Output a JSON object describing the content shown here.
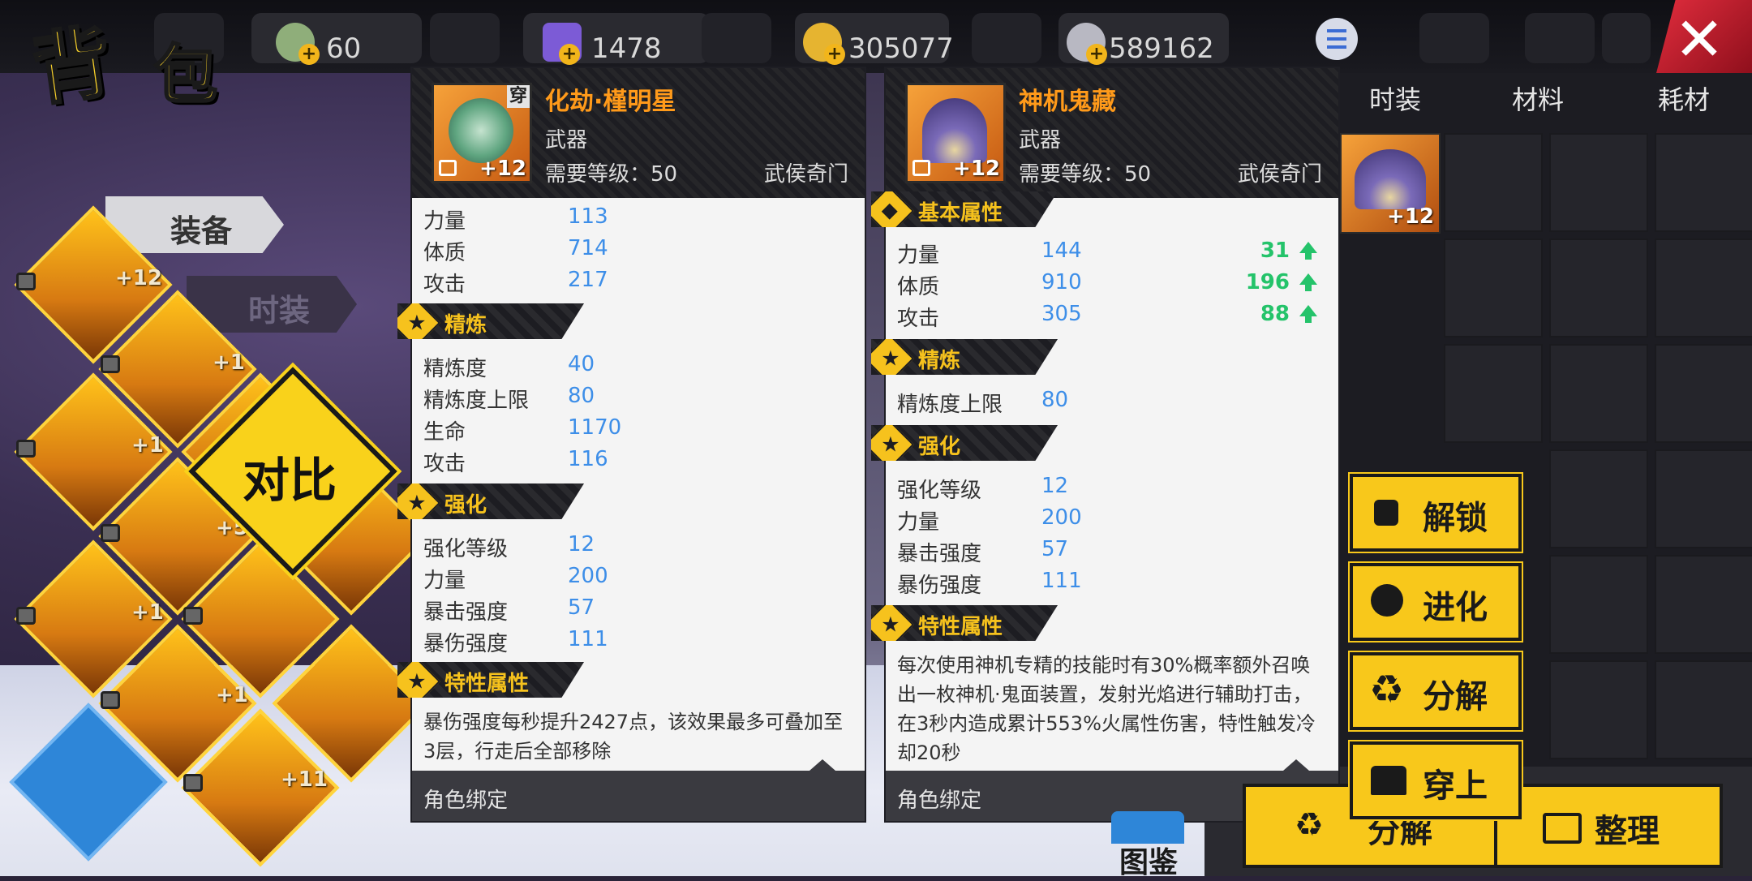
{
  "window": {
    "title_chars": [
      "背",
      "包"
    ]
  },
  "resources": [
    {
      "name": "voucher",
      "value": "60",
      "color": "#8fae7a"
    },
    {
      "name": "crystal",
      "value": "1478",
      "color": "#7c5bd6"
    },
    {
      "name": "gold",
      "value": "305077",
      "color": "#e6b430"
    },
    {
      "name": "silver",
      "value": "589162",
      "color": "#b8b8c2"
    }
  ],
  "left_tabs": {
    "equip": "装备",
    "fashion": "时装"
  },
  "compare_label": "对比",
  "slots_plus": [
    "+12",
    "+1",
    "+1",
    "+5",
    "+1",
    "+1",
    "+1",
    "+11"
  ],
  "panel_left": {
    "equipped_badge": "穿",
    "name": "化劫·槿明星",
    "type": "武器",
    "level": "需要等级：50",
    "class": "武侯奇门",
    "plus": "+12",
    "base": [
      {
        "label": "力量",
        "value": "113"
      },
      {
        "label": "体质",
        "value": "714"
      },
      {
        "label": "攻击",
        "value": "217"
      }
    ],
    "refine_title": "精炼",
    "refine": [
      {
        "label": "精炼度",
        "value": "40"
      },
      {
        "label": "精炼度上限",
        "value": "80"
      },
      {
        "label": "生命",
        "value": "1170"
      },
      {
        "label": "攻击",
        "value": "116"
      }
    ],
    "enhance_title": "强化",
    "enhance": [
      {
        "label": "强化等级",
        "value": "12"
      },
      {
        "label": "力量",
        "value": "200"
      },
      {
        "label": "暴击强度",
        "value": "57"
      },
      {
        "label": "暴伤强度",
        "value": "111"
      }
    ],
    "trait_title": "特性属性",
    "trait_text": "暴伤强度每秒提升2427点，该效果最多可叠加至3层，行走后全部移除",
    "footer": "角色绑定"
  },
  "panel_right": {
    "name": "神机鬼藏",
    "type": "武器",
    "level": "需要等级：50",
    "class": "武侯奇门",
    "plus": "+12",
    "base_title": "基本属性",
    "base": [
      {
        "label": "力量",
        "value": "144",
        "diff": "31"
      },
      {
        "label": "体质",
        "value": "910",
        "diff": "196"
      },
      {
        "label": "攻击",
        "value": "305",
        "diff": "88"
      }
    ],
    "refine_title": "精炼",
    "refine": [
      {
        "label": "精炼度上限",
        "value": "80"
      }
    ],
    "enhance_title": "强化",
    "enhance": [
      {
        "label": "强化等级",
        "value": "12"
      },
      {
        "label": "力量",
        "value": "200"
      },
      {
        "label": "暴击强度",
        "value": "57"
      },
      {
        "label": "暴伤强度",
        "value": "111"
      }
    ],
    "trait_title": "特性属性",
    "trait_text": "每次使用神机专精的技能时有30%概率额外召唤出一枚神机·鬼面装置，发射光焰进行辅助打击，在3秒内造成累计553%火属性伤害，特性触发冷却20秒",
    "footer": "角色绑定"
  },
  "right_tabs": [
    "时装",
    "材料",
    "耗材"
  ],
  "grid_item_plus": "+12",
  "actions": [
    "解锁",
    "进化",
    "分解",
    "穿上"
  ],
  "bottom_buttons": {
    "decompose": "分解",
    "sort": "整理"
  },
  "atlas_label": "图鉴"
}
